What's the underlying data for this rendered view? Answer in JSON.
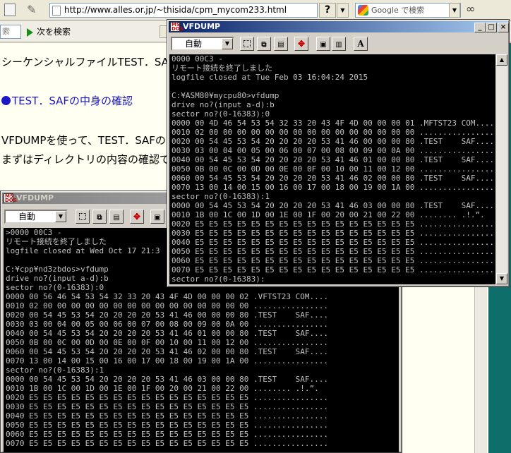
{
  "browser": {
    "url": "http://www.alles.or.jp/~thisida/cpm_mycom233.html",
    "help_label": "?",
    "search_placeholder": "Google で検索",
    "find_placeholder": "索",
    "next_label": "次を検索"
  },
  "webpage": {
    "line1": "シーケンシャルファイルTEST．SAI",
    "heading": "TEST．SAFの中身の確認",
    "line2": "VFDUMPを使って、TEST．SAFの",
    "line3": "まずはディレクトリの内容の確認で"
  },
  "win_front": {
    "title": "VFDUMP",
    "select_value": "自動",
    "font_button": "A",
    "lines": [
      "0000 00C3 -",
      "リモート接続を終了しました",
      "logfile closed at Tue Feb 03 16:04:24 2015",
      "",
      "C:¥ASM80¥mycpu80>vfdump",
      "drive no?(input a-d):b",
      "sector no?(0-16383):0",
      "0000 00 4D 46 54 53 54 32 33 20 43 4F 4D 00 00 00 01 .MFTST23 COM....",
      "0010 02 00 00 00 00 00 00 00 00 00 00 00 00 00 00 00 ................",
      "0020 00 54 45 53 54 20 20 20 20 53 41 46 00 00 00 80 .TEST    SAF....",
      "0030 03 00 04 00 05 00 06 00 07 00 08 00 09 00 0A 00 ................",
      "0040 00 54 45 53 54 20 20 20 20 53 41 46 01 00 00 80 .TEST    SAF....",
      "0050 0B 00 0C 00 0D 00 0E 00 0F 00 10 00 11 00 12 00 ................",
      "0060 00 54 45 53 54 20 20 20 20 53 41 46 02 00 00 80 .TEST    SAF....",
      "0070 13 00 14 00 15 00 16 00 17 00 18 00 19 00 1A 00 ................",
      "sector no?(0-16383):1",
      "0000 00 54 45 53 54 20 20 20 20 53 41 46 03 00 00 80 .TEST    SAF....",
      "0010 1B 00 1C 00 1D 00 1E 00 1F 00 20 00 21 00 22 00 ........ .!.”.",
      "0020 E5 E5 E5 E5 E5 E5 E5 E5 E5 E5 E5 E5 E5 E5 E5 E5 ................",
      "0030 E5 E5 E5 E5 E5 E5 E5 E5 E5 E5 E5 E5 E5 E5 E5 E5 ................",
      "0040 E5 E5 E5 E5 E5 E5 E5 E5 E5 E5 E5 E5 E5 E5 E5 E5 ................",
      "0050 E5 E5 E5 E5 E5 E5 E5 E5 E5 E5 E5 E5 E5 E5 E5 E5 ................",
      "0060 E5 E5 E5 E5 E5 E5 E5 E5 E5 E5 E5 E5 E5 E5 E5 E5 ................",
      "0070 E5 E5 E5 E5 E5 E5 E5 E5 E5 E5 E5 E5 E5 E5 E5 E5 ................",
      "sector no?(0-16383):"
    ]
  },
  "win_back": {
    "title": "VFDUMP",
    "select_value": "自動",
    "lines": [
      ">0000 00C3 -",
      "リモート接続を終了しました",
      "logfile closed at Wed Oct 17 21:3",
      "",
      "C:¥cpp¥nd3zbdos>vfdump",
      "drive no?(input a-d):b",
      "sector no?(0-16383):0",
      "0000 00 56 46 54 53 54 32 33 20 43 4F 4D 00 00 00 02 .VFTST23 COM....",
      "0010 02 00 00 00 00 00 00 00 00 00 00 00 00 00 00 00 ................",
      "0020 00 54 45 53 54 20 20 20 20 53 41 46 00 00 00 80 .TEST    SAF....",
      "0030 03 00 04 00 05 00 06 00 07 00 08 00 09 00 0A 00 ................",
      "0040 00 54 45 53 54 20 20 20 20 53 41 46 01 00 00 80 .TEST    SAF....",
      "0050 0B 00 0C 00 0D 00 0E 00 0F 00 10 00 11 00 12 00 ................",
      "0060 00 54 45 53 54 20 20 20 20 53 41 46 02 00 00 80 .TEST    SAF....",
      "0070 13 00 14 00 15 00 16 00 17 00 18 00 19 00 1A 00 ................",
      "sector no?(0-16383):1",
      "0000 00 54 45 53 54 20 20 20 20 53 41 46 03 00 00 80 .TEST    SAF....",
      "0010 1B 00 1C 00 1D 00 1E 00 1F 00 20 00 21 00 22 00 ........ .!.”.",
      "0020 E5 E5 E5 E5 E5 E5 E5 E5 E5 E5 E5 E5 E5 E5 E5 E5 ................",
      "0030 E5 E5 E5 E5 E5 E5 E5 E5 E5 E5 E5 E5 E5 E5 E5 E5 ................",
      "0040 E5 E5 E5 E5 E5 E5 E5 E5 E5 E5 E5 E5 E5 E5 E5 E5 ................",
      "0050 E5 E5 E5 E5 E5 E5 E5 E5 E5 E5 E5 E5 E5 E5 E5 E5 ................",
      "0060 E5 E5 E5 E5 E5 E5 E5 E5 E5 E5 E5 E5 E5 E5 E5 E5 ................",
      "0070 E5 E5 E5 E5 E5 E5 E5 E5 E5 E5 E5 E5 E5 E5 E5 E5 ................"
    ]
  },
  "window_buttons": {
    "minimize": "_",
    "maximize": "□",
    "close": "×"
  }
}
